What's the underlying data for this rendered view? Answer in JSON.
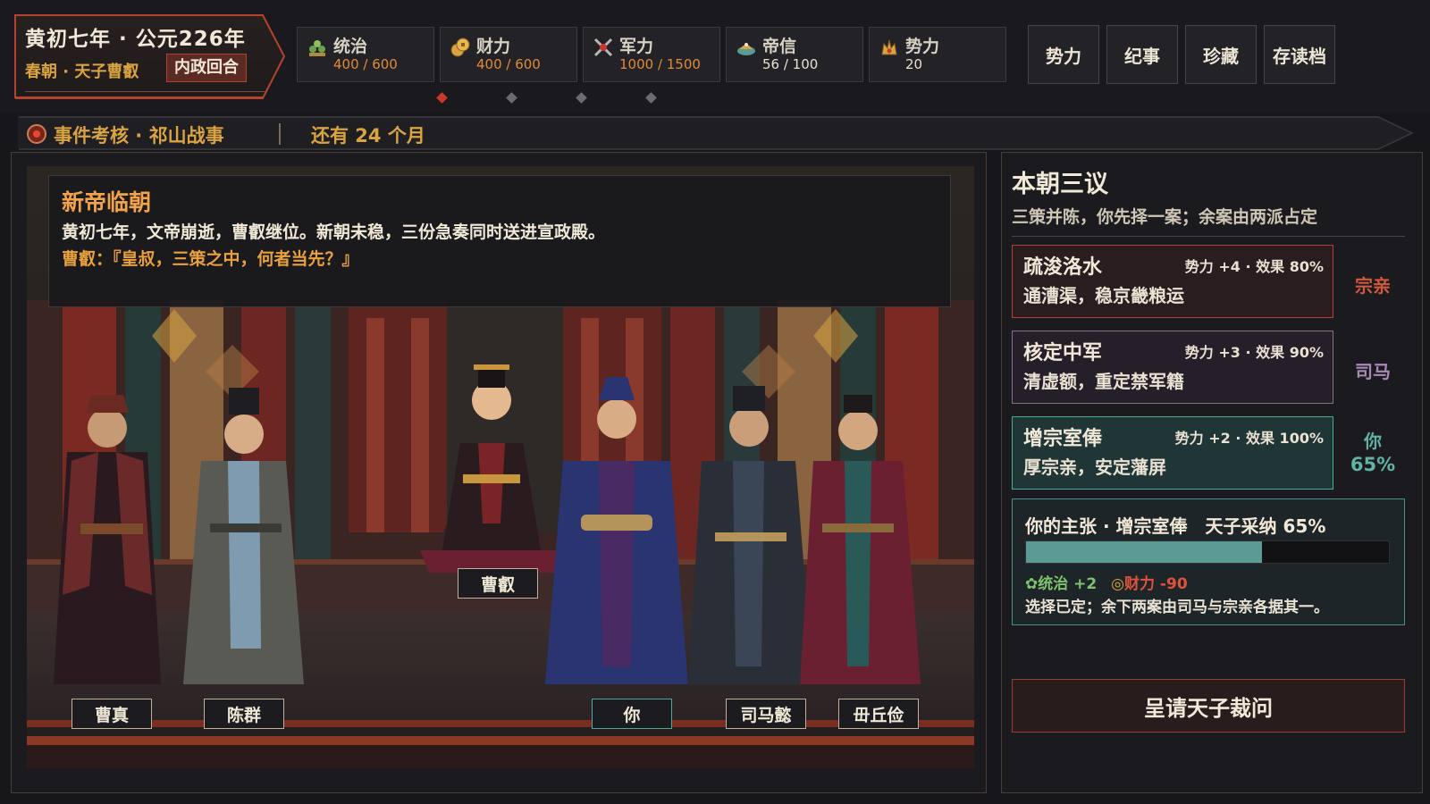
{
  "header": {
    "date_line": "黄初七年 · 公元226年",
    "court": "春朝 · 天子曹叡",
    "phase": "内政回合"
  },
  "stats": [
    {
      "icon": "governance-icon",
      "label": "统治",
      "value": "400 / 600"
    },
    {
      "icon": "treasury-icon",
      "label": "财力",
      "value": "400 / 600"
    },
    {
      "icon": "military-icon",
      "label": "军力",
      "value": "1000 / 1500"
    },
    {
      "icon": "imperial-trust-icon",
      "label": "帝信",
      "value": "56 / 100"
    },
    {
      "icon": "influence-icon",
      "label": "势力",
      "value": "20"
    }
  ],
  "nav": [
    "势力",
    "纪事",
    "珍藏",
    "存读档"
  ],
  "event": {
    "title": "事件考核 · 祁山战事",
    "remaining": "还有 24 个月"
  },
  "story": {
    "title": "新帝临朝",
    "text": "黄初七年，文帝崩逝，曹叡继位。新朝未稳，三份急奏同时送进宣政殿。",
    "quote": "曹叡：『皇叔，三策之中，何者当先？』"
  },
  "characters": [
    {
      "name": "曹叡"
    },
    {
      "name": "曹真"
    },
    {
      "name": "陈群"
    },
    {
      "name": "你"
    },
    {
      "name": "司马懿"
    },
    {
      "name": "毌丘俭"
    }
  ],
  "panel": {
    "title": "本朝三议",
    "subtitle": "三策并陈，你先择一案；余案由两派占定"
  },
  "options": [
    {
      "title": "疏浚洛水",
      "stats": "势力 +4 · 效果 80%",
      "desc": "通漕渠，稳京畿粮运",
      "faction": "宗亲",
      "faction_color": "#d05a3c"
    },
    {
      "title": "核定中军",
      "stats": "势力 +3 · 效果 90%",
      "desc": "清虚额，重定禁军籍",
      "faction": "司马",
      "faction_color": "#a889b6"
    },
    {
      "title": "增宗室俸",
      "stats": "势力 +2 · 效果 100%",
      "desc": "厚宗亲，安定藩屏",
      "faction": "你",
      "faction_pct": "65%",
      "faction_color": "#5fb3a8"
    }
  ],
  "proposal": {
    "head": "你的主张 · 增宗室俸　天子采纳 65%",
    "adoption": 0.65,
    "effect_gov": "统治 +2",
    "effect_money": "财力 -90",
    "note": "选择已定；余下两案由司马与宗亲各据其一。"
  },
  "submit_label": "呈请天子裁问",
  "colors": {
    "accent_red": "#b4432d",
    "gold": "#d9a441",
    "teal": "#4fa79c",
    "purple": "#8a6e90",
    "orange_value": "#e28a3b",
    "green_effect": "#7fc26f",
    "red_effect": "#e0523c"
  }
}
